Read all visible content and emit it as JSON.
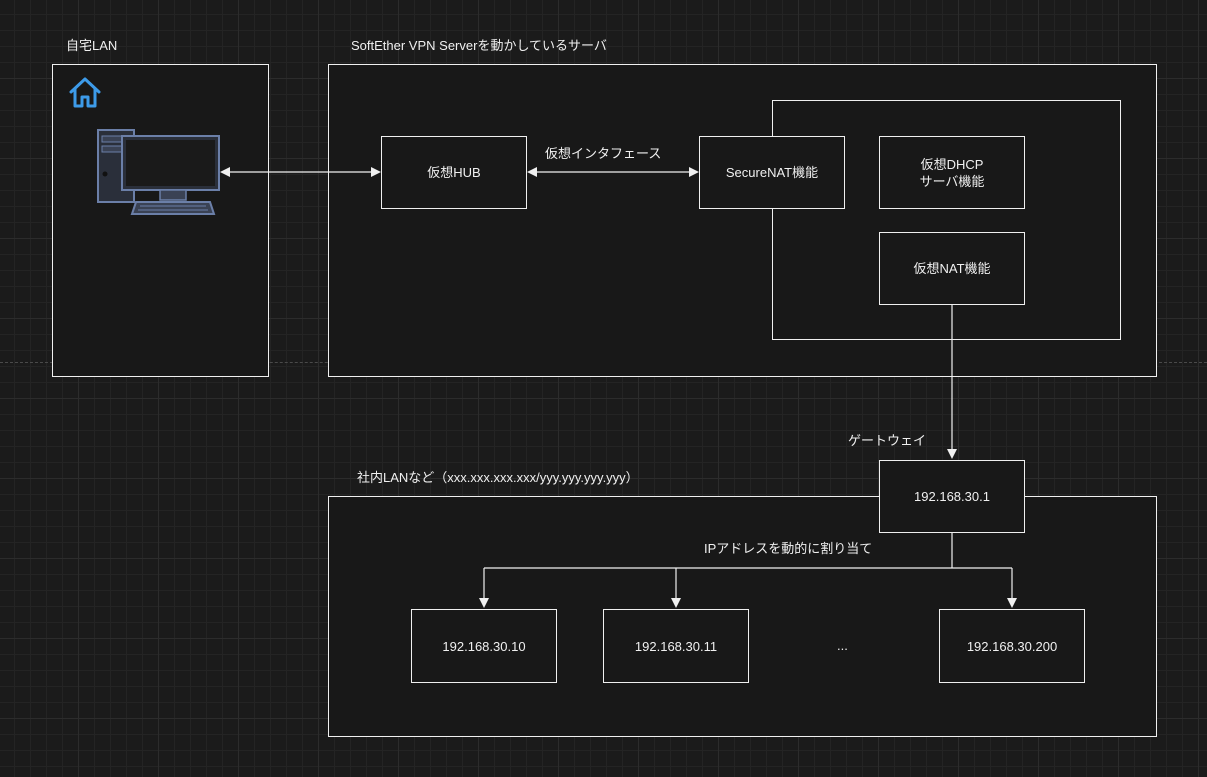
{
  "home": {
    "title": "自宅LAN",
    "icon": "home-icon",
    "pc_icon": "desktop-computer-icon",
    "icon_color": "#3d9be9"
  },
  "server": {
    "title": "SoftEther VPN Serverを動かしているサーバ",
    "hub": "仮想HUB",
    "interface_label": "仮想インタフェース",
    "securenat": "SecureNAT機能",
    "dhcp": "仮想DHCP\nサーバ機能",
    "nat": "仮想NAT機能"
  },
  "lan": {
    "title": "社内LANなど（xxx.xxx.xxx.xxx/yyy.yyy.yyy.yyy）",
    "gateway_label": "ゲートウェイ",
    "gateway_ip": "192.168.30.1",
    "assign_label": "IPアドレスを動的に割り当て",
    "hosts": [
      "192.168.30.10",
      "192.168.30.11",
      "...",
      "192.168.30.200"
    ]
  },
  "colors": {
    "line": "#f0f0f0",
    "background": "#1b1b1b",
    "box_fill": "#181818",
    "icon": "#3d9be9"
  }
}
